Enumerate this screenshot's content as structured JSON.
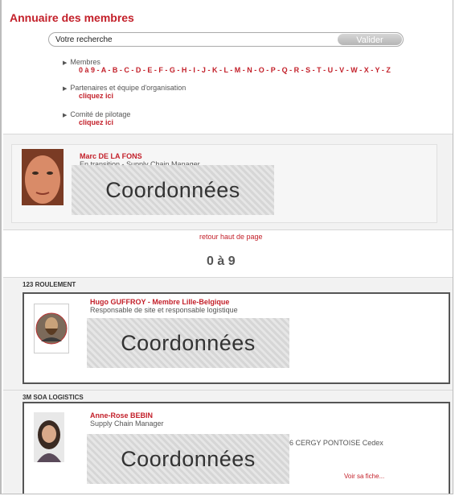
{
  "header": {
    "title": "Annuaire des membres"
  },
  "search": {
    "placeholder": "Votre recherche",
    "button": "Valider"
  },
  "nav": {
    "members": {
      "label": "Membres",
      "letters": [
        "0 à 9",
        "A",
        "B",
        "C",
        "D",
        "E",
        "F",
        "G",
        "H",
        "I",
        "J",
        "K",
        "L",
        "M",
        "N",
        "O",
        "P",
        "Q",
        "R",
        "S",
        "T",
        "U",
        "V",
        "W",
        "X",
        "Y",
        "Z"
      ]
    },
    "partners": {
      "label": "Partenaires et équipe d'organisation",
      "link": "cliquez ici"
    },
    "committee": {
      "label": "Comité de pilotage",
      "link": "cliquez ici"
    }
  },
  "featured": {
    "name": "Marc DE LA FONS",
    "subtitle": "En transition - Supply Chain Manager",
    "coordinates": "Coordonnées"
  },
  "back_to_top": "retour haut de page",
  "section_heading": "0 à 9",
  "companies": [
    {
      "company": "123 ROULEMENT",
      "name": "Hugo GUFFROY - Membre Lille-Belgique",
      "role": "Responsable de site et responsable logistique",
      "coordinates": "Coordonnées"
    },
    {
      "company": "3M SOA LOGISTICS",
      "name": "Anne-Rose BEBIN",
      "role": "Supply Chain Manager",
      "coordinates": "Coordonnées",
      "address": "6 CERGY PONTOISE Cedex",
      "more": "Voir sa fiche..."
    }
  ],
  "colors": {
    "accent": "#c3202a",
    "panel": "#f2f2f2"
  }
}
